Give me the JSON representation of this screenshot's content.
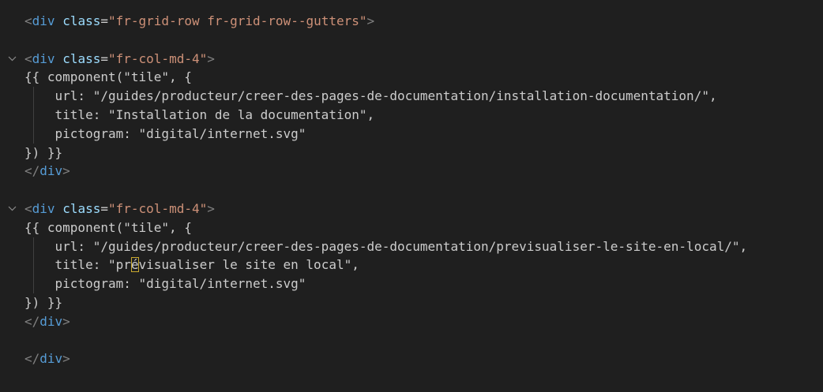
{
  "lines": {
    "l1": {
      "a": "<",
      "b": "div",
      "c": " ",
      "d": "class",
      "e": "=",
      "f": "\"fr-grid-row fr-grid-row--gutters\"",
      "g": ">"
    },
    "l3": {
      "a": "<",
      "b": "div",
      "c": " ",
      "d": "class",
      "e": "=",
      "f": "\"fr-col-md-4\"",
      "g": ">"
    },
    "l4": {
      "t": "{{ component(\"tile\", {"
    },
    "l5": {
      "t": "    url: \"/guides/producteur/creer-des-pages-de-documentation/installation-documentation/\","
    },
    "l6": {
      "t": "    title: \"Installation de la documentation\","
    },
    "l7": {
      "t": "    pictogram: \"digital/internet.svg\""
    },
    "l8": {
      "t": "}) }}"
    },
    "l9": {
      "a": "</",
      "b": "div",
      "g": ">"
    },
    "l11": {
      "a": "<",
      "b": "div",
      "c": " ",
      "d": "class",
      "e": "=",
      "f": "\"fr-col-md-4\"",
      "g": ">"
    },
    "l12": {
      "t": "{{ component(\"tile\", {"
    },
    "l13": {
      "t": "    url: \"/guides/producteur/creer-des-pages-de-documentation/previsualiser-le-site-en-local/\","
    },
    "l14": {
      "pre": "    title: \"pr",
      "cur": "é",
      "post": "visualiser le site en local\","
    },
    "l15": {
      "t": "    pictogram: \"digital/internet.svg\""
    },
    "l16": {
      "t": "}) }}"
    },
    "l17": {
      "a": "</",
      "b": "div",
      "g": ">"
    },
    "l19": {
      "a": "</",
      "b": "div",
      "g": ">"
    }
  },
  "icons": {
    "fold": "chevron-down-icon"
  },
  "colors": {
    "background": "#1f1f1f",
    "tag": "#569cd6",
    "punctuation": "#808080",
    "attribute": "#9cdcfe",
    "string": "#ce9178",
    "text": "#cccccc",
    "cursor_highlight": "#c8a82e"
  }
}
